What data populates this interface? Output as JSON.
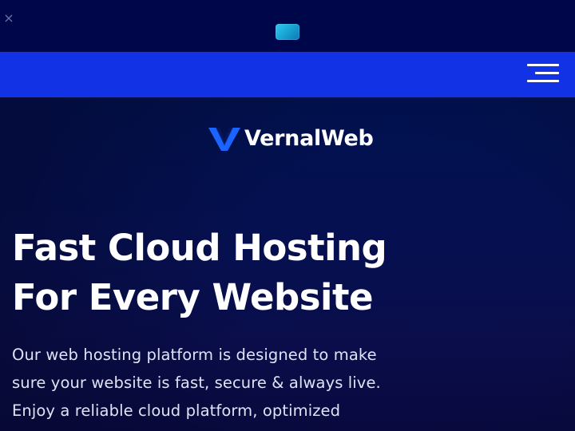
{
  "banner": {
    "close_icon": "close-icon",
    "close_glyph": "×",
    "image": "promo-banner-image"
  },
  "nav": {
    "menu_icon": "hamburger-menu-icon"
  },
  "brand": {
    "logo_icon": "vernalweb-logo-icon",
    "name": "VernalWeb"
  },
  "hero": {
    "title_lines": [
      "Fast Cloud Hosting",
      "For Every Website"
    ],
    "description_lines": [
      "Our web hosting platform is designed to make",
      "sure your website is fast, secure & always live.",
      "Enjoy a reliable cloud platform, optimized"
    ]
  },
  "colors": {
    "banner_bg": "#00064a",
    "nav_bg": "#1232e6",
    "hero_bg": "#061050",
    "logo_accent": "#1c64ff",
    "text": "#ffffff"
  }
}
